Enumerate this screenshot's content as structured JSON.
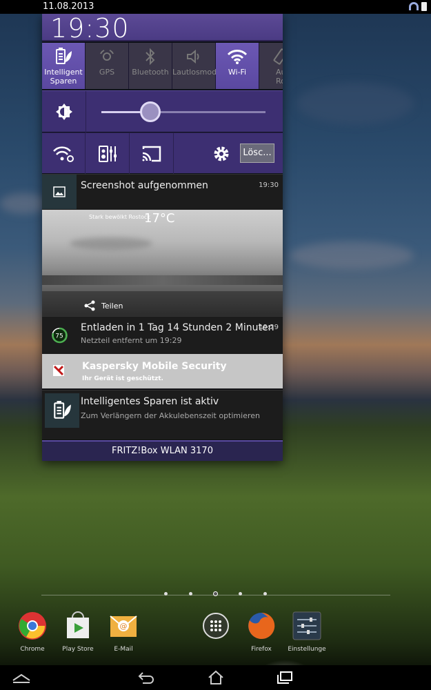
{
  "status_bar": {
    "date": "11.08.2013"
  },
  "notification_panel": {
    "clock": "19:30",
    "quick_settings": [
      {
        "label": "Intelligent Sparen",
        "icon": "battery-leaf-icon",
        "active": true
      },
      {
        "label": "GPS",
        "icon": "gps-icon",
        "active": false
      },
      {
        "label": "Bluetooth",
        "icon": "bluetooth-icon",
        "active": false
      },
      {
        "label": "Lautlosmodus",
        "icon": "speaker-mute-icon",
        "active": false
      },
      {
        "label": "Wi-Fi",
        "icon": "wifi-icon",
        "active": true
      },
      {
        "label": "Auto-Rotation",
        "icon": "rotate-icon",
        "active": false
      }
    ],
    "brightness": {
      "level": 0.3
    },
    "tools": {
      "clear_label": "Lösc..."
    },
    "notifications": [
      {
        "title": "Screenshot aufgenommen",
        "time": "19:30",
        "icon": "image-icon"
      },
      {
        "title": "Entladen in 1 Tag 14 Stunden 2 Minuten",
        "subtitle": "Netzteil entfernt um 19:29",
        "time": "19:29",
        "icon": "battery-percent-icon",
        "badge": "75"
      },
      {
        "title": "Kaspersky Mobile Security",
        "subtitle": "Ihr Gerät ist geschützt.",
        "icon": "kaspersky-icon"
      },
      {
        "title": "Intelligentes Sparen ist aktiv",
        "subtitle": "Zum Verlängern der Akkulebenszeit optimieren",
        "icon": "battery-leaf-icon"
      }
    ],
    "screenshot_preview": {
      "share_label": "Teilen",
      "mini_location": "Stark bewölkt Rostock",
      "mini_temp": "17°C"
    },
    "wifi_network": "FRITZ!Box WLAN 3170"
  },
  "dock": [
    {
      "label": "Chrome",
      "icon": "chrome-icon"
    },
    {
      "label": "Play Store",
      "icon": "play-store-icon"
    },
    {
      "label": "E-Mail",
      "icon": "email-icon"
    },
    {
      "label": "Firefox",
      "icon": "firefox-icon"
    },
    {
      "label": "Einstellunge",
      "icon": "settings-app-icon"
    }
  ],
  "colors": {
    "accent": "#5a48a0",
    "panel_header": "#4b3b84"
  }
}
